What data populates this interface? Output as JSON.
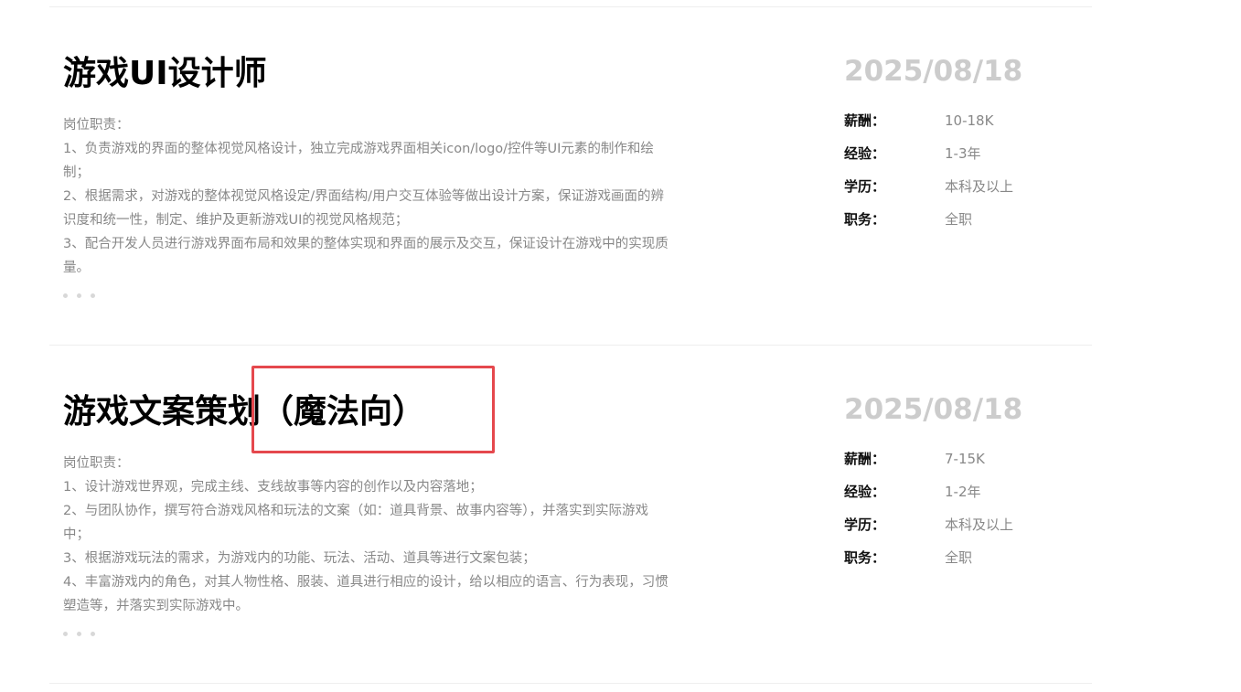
{
  "jobs": [
    {
      "title": "游戏UI设计师",
      "date": "2025/08/18",
      "desc_lines": [
        "岗位职责：",
        "1、负责游戏的界面的整体视觉风格设计，独立完成游戏界面相关icon/logo/控件等UI元素的制作和绘",
        "制；",
        "2、根据需求，对游戏的整体视觉风格设定/界面结构/用户交互体验等做出设计方案，保证游戏画面的辨",
        "识度和统一性，制定、维护及更新游戏UI的视觉风格规范；",
        "3、配合开发人员进行游戏界面布局和效果的整体实现和界面的展示及交互，保证设计在游戏中的实现质",
        "量。"
      ],
      "meta": [
        {
          "key": "薪酬：",
          "value": "10-18K"
        },
        {
          "key": "经验：",
          "value": "1-3年"
        },
        {
          "key": "学历：",
          "value": "本科及以上"
        },
        {
          "key": "职务：",
          "value": "全职"
        }
      ]
    },
    {
      "title": "游戏文案策划（魔法向）",
      "date": "2025/08/18",
      "desc_lines": [
        "岗位职责：",
        "1、设计游戏世界观，完成主线、支线故事等内容的创作以及内容落地；",
        "2、与团队协作，撰写符合游戏风格和玩法的文案（如：道具背景、故事内容等），并落实到实际游戏",
        "中；",
        "3、根据游戏玩法的需求，为游戏内的功能、玩法、活动、道具等进行文案包装；",
        "4、丰富游戏内的角色，对其人物性格、服装、道具进行相应的设计，给以相应的语言、行为表现，习惯",
        "塑造等，并落实到实际游戏中。"
      ],
      "meta": [
        {
          "key": "薪酬：",
          "value": "7-15K"
        },
        {
          "key": "经验：",
          "value": "1-2年"
        },
        {
          "key": "学历：",
          "value": "本科及以上"
        },
        {
          "key": "职务：",
          "value": "全职"
        }
      ]
    }
  ],
  "colors": {
    "title": "#000000",
    "desc": "#888888",
    "date": "#cccccc",
    "highlight": "#e5484d"
  }
}
